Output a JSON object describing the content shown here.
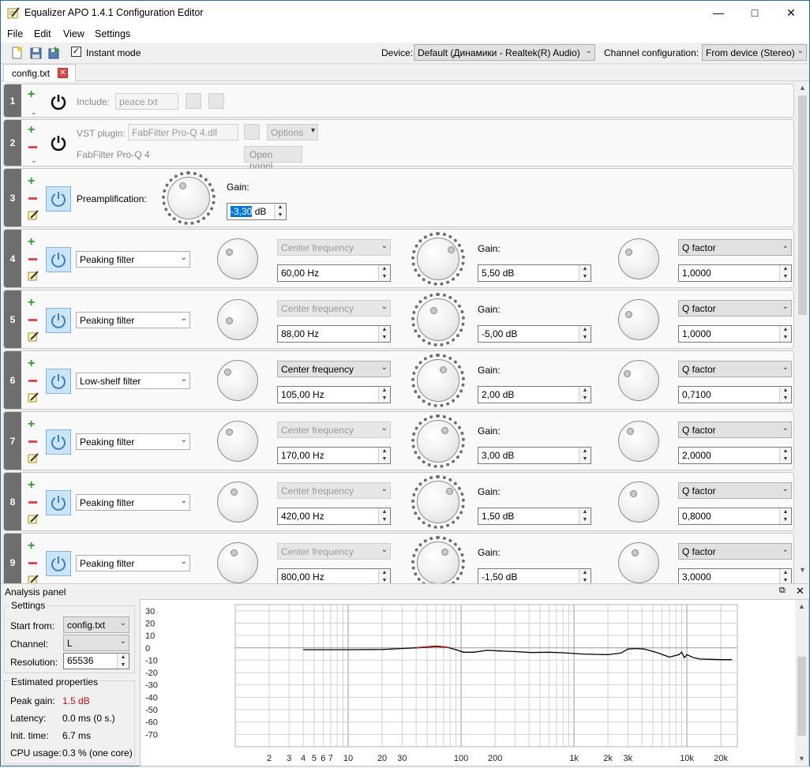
{
  "window": {
    "title": "Equalizer APO 1.4.1 Configuration Editor"
  },
  "menu": [
    "File",
    "Edit",
    "View",
    "Settings"
  ],
  "toolbar": {
    "instant_mode_label": "Instant mode",
    "instant_mode_checked": true,
    "device_label": "Device:",
    "device_value": "Default (Динамики - Realtek(R) Audio)",
    "channel_label": "Channel configuration:",
    "channel_value": "From device (Stereo)"
  },
  "tab": {
    "label": "config.txt"
  },
  "rows": {
    "r1": {
      "num": "1",
      "include_label": "Include:",
      "include_value": "peace.txt"
    },
    "r2": {
      "num": "2",
      "vst_label": "VST plugin:",
      "vst_value": "FabFilter Pro-Q 4.dll",
      "options_label": "Options",
      "plugin_name": "FabFilter Pro-Q 4",
      "open_panel_label": "Open panel"
    },
    "r3": {
      "num": "3",
      "preamp_label": "Preamplification:",
      "gain_label": "Gain:",
      "gain_value": "-3,30",
      "gain_unit": "dB"
    },
    "filters": [
      {
        "num": "4",
        "type": "Peaking filter",
        "freq_mode": "Center frequency",
        "freq": "60,00 Hz",
        "gain_label": "Gain:",
        "gain": "5,50 dB",
        "q_mode": "Q factor",
        "q": "1,0000"
      },
      {
        "num": "5",
        "type": "Peaking filter",
        "freq_mode": "Center frequency",
        "freq": "88,00 Hz",
        "gain_label": "Gain:",
        "gain": "-5,00 dB",
        "q_mode": "Q factor",
        "q": "1,0000"
      },
      {
        "num": "6",
        "type": "Low-shelf filter",
        "freq_mode": "Center frequency",
        "freq": "105,00 Hz",
        "gain_label": "Gain:",
        "gain": "2,00 dB",
        "q_mode": "Q factor",
        "q": "0,7100"
      },
      {
        "num": "7",
        "type": "Peaking filter",
        "freq_mode": "Center frequency",
        "freq": "170,00 Hz",
        "gain_label": "Gain:",
        "gain": "3,00 dB",
        "q_mode": "Q factor",
        "q": "2,0000"
      },
      {
        "num": "8",
        "type": "Peaking filter",
        "freq_mode": "Center frequency",
        "freq": "420,00 Hz",
        "gain_label": "Gain:",
        "gain": "1,50 dB",
        "q_mode": "Q factor",
        "q": "0,8000"
      },
      {
        "num": "9",
        "type": "Peaking filter",
        "freq_mode": "Center frequency",
        "freq": "800,00 Hz",
        "gain_label": "Gain:",
        "gain": "-1,50 dB",
        "q_mode": "Q factor",
        "q": "3,0000"
      }
    ]
  },
  "analysis": {
    "title": "Analysis panel",
    "settings_label": "Settings",
    "start_from_label": "Start from:",
    "start_from_value": "config.txt",
    "channel_label": "Channel:",
    "channel_value": "L",
    "resolution_label": "Resolution:",
    "resolution_value": "65536",
    "estimated_label": "Estimated properties",
    "peak_gain_label": "Peak gain:",
    "peak_gain_value": "1.5 dB",
    "latency_label": "Latency:",
    "latency_value": "0.0 ms (0 s.)",
    "init_time_label": "Init. time:",
    "init_time_value": "6.7 ms",
    "cpu_label": "CPU usage:",
    "cpu_value": "0.3 % (one core)"
  },
  "chart_data": {
    "type": "line",
    "title": "",
    "xlabel": "",
    "ylabel": "",
    "x_scale": "log",
    "xlim": [
      1,
      28000
    ],
    "ylim": [
      -80,
      35
    ],
    "x_ticks": [
      2,
      3,
      4,
      5,
      6,
      7,
      10,
      20,
      30,
      100,
      200,
      1000,
      2000,
      3000,
      10000,
      20000
    ],
    "x_tick_labels": [
      "2",
      "3",
      "4",
      "5",
      "6",
      "7",
      "10",
      "20",
      "30",
      "100",
      "200",
      "1k",
      "2k",
      "3k",
      "10k",
      "20k"
    ],
    "y_ticks": [
      30,
      20,
      10,
      0,
      -10,
      -20,
      -30,
      -40,
      -50,
      -60,
      -70
    ],
    "grid": true,
    "series": [
      {
        "color": "#000000",
        "x": [
          4,
          10,
          20,
          30,
          45,
          60,
          75,
          90,
          105,
          130,
          170,
          220,
          300,
          420,
          600,
          800,
          1200,
          2000,
          2600,
          3000,
          3500,
          4200,
          5500,
          7000,
          8500,
          9000,
          9500,
          10000,
          11500,
          13000,
          16000,
          20000,
          25000
        ],
        "y": [
          -1.5,
          -1.5,
          -1.3,
          -0.5,
          0.3,
          1.0,
          0.5,
          -1.5,
          -3.5,
          -3.5,
          -2.0,
          -2.5,
          -3.0,
          -3.8,
          -3.5,
          -4.0,
          -5.0,
          -5.5,
          -4.2,
          -1.0,
          -0.5,
          -1.0,
          -4.0,
          -7.5,
          -5.5,
          -3.5,
          -8.0,
          -5.5,
          -8.0,
          -9.0,
          -9.3,
          -9.5,
          -9.5
        ]
      },
      {
        "color": "#d01010",
        "x": [
          40,
          50,
          60,
          70,
          80
        ],
        "y": [
          0.2,
          0.9,
          1.5,
          0.9,
          0.2
        ]
      }
    ]
  }
}
